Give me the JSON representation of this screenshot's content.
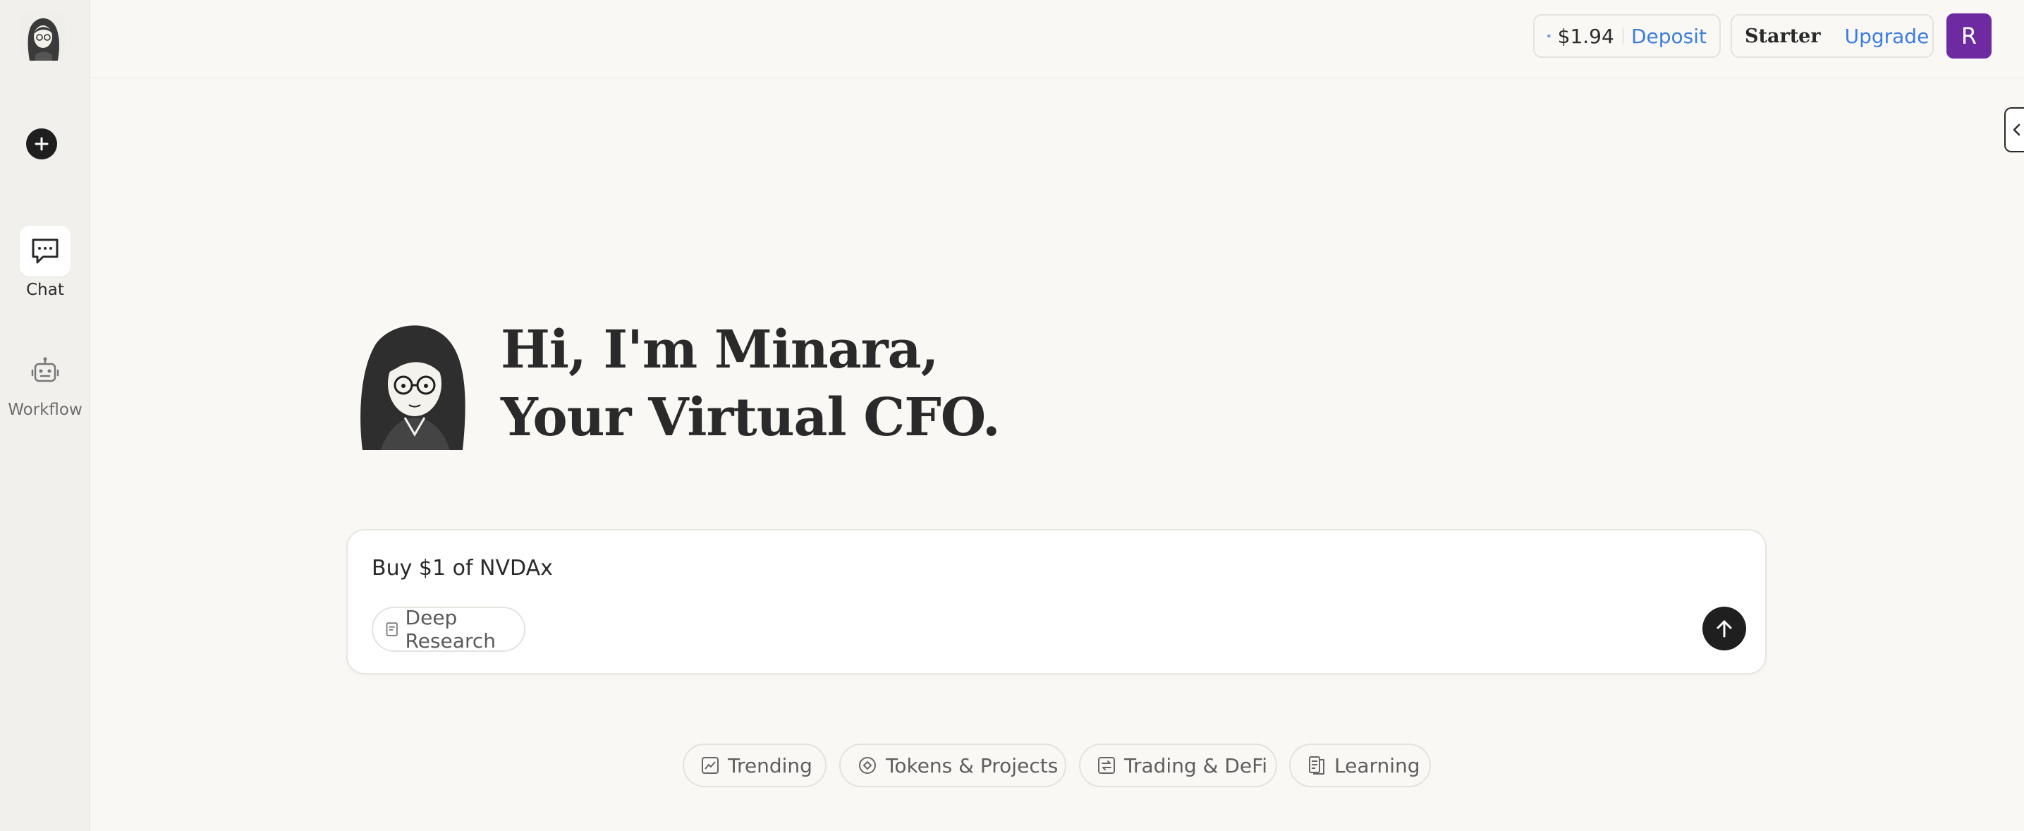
{
  "sidebar": {
    "logo_icon": "minara-portrait-icon",
    "new_chat_icon": "plus-circle-icon",
    "items": [
      {
        "label": "Chat",
        "icon": "chat-bubble-icon",
        "active": true
      },
      {
        "label": "Workflow",
        "icon": "robot-icon",
        "active": false
      }
    ]
  },
  "topbar": {
    "balance": {
      "icon": "usdc-coin-icon",
      "amount": "$1.94",
      "action": "Deposit"
    },
    "plan": {
      "name": "Starter",
      "icon": "box-icon",
      "action": "Upgrade"
    },
    "avatar_initial": "R",
    "colors": {
      "link": "#3c7de0",
      "avatar": "#6d2aa1"
    }
  },
  "hero": {
    "title_line1": "Hi, I'm Minara,",
    "title_line2": "Your Virtual CFO."
  },
  "composer": {
    "input_value": "Buy $1 of NVDAx",
    "deep_research_label": "Deep Research",
    "send_icon": "arrow-up-icon"
  },
  "suggestions": [
    {
      "label": "Trending",
      "icon": "trend-chart-icon"
    },
    {
      "label": "Tokens & Projects",
      "icon": "token-icon"
    },
    {
      "label": "Trading & DeFi",
      "icon": "trading-icon"
    },
    {
      "label": "Learning",
      "icon": "book-icon"
    }
  ]
}
